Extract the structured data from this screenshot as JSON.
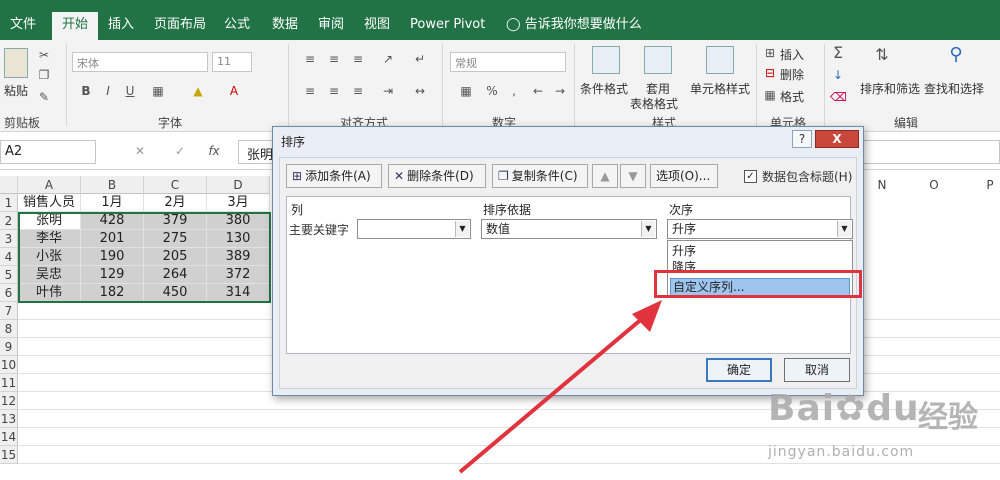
{
  "ribbon": {
    "tabs": [
      {
        "label": "文件"
      },
      {
        "label": "开始"
      },
      {
        "label": "插入"
      },
      {
        "label": "页面布局"
      },
      {
        "label": "公式"
      },
      {
        "label": "数据"
      },
      {
        "label": "审阅"
      },
      {
        "label": "视图"
      },
      {
        "label": "Power Pivot"
      }
    ],
    "tell_me": "告诉我你想要做什么",
    "clipboard": {
      "paste": "粘贴",
      "label": "剪贴板"
    },
    "font": {
      "name": "宋体",
      "size": "11",
      "label": "字体"
    },
    "alignment": {
      "label": "对齐方式"
    },
    "number": {
      "format": "常规",
      "label": "数字"
    },
    "styles": {
      "conditional": "条件格式",
      "table_format_1": "套用",
      "table_format_2": "表格格式",
      "cell_styles": "单元格样式",
      "label": "样式"
    },
    "cells": {
      "insert": "插入",
      "delete": "删除",
      "format": "格式",
      "label": "单元格"
    },
    "editing": {
      "sort_filter": "排序和筛选",
      "find_select": "查找和选择",
      "label": "编辑"
    }
  },
  "formula_bar": {
    "name_box": "A2",
    "content": "张明"
  },
  "sheet": {
    "columns": [
      "A",
      "B",
      "C",
      "D"
    ],
    "right_columns": [
      "N",
      "O",
      "P"
    ],
    "rows": [
      [
        "销售人员",
        "1月",
        "2月",
        "3月"
      ],
      [
        "张明",
        "428",
        "379",
        "380"
      ],
      [
        "李华",
        "201",
        "275",
        "130"
      ],
      [
        "小张",
        "190",
        "205",
        "389"
      ],
      [
        "吴忠",
        "129",
        "264",
        "372"
      ],
      [
        "叶伟",
        "182",
        "450",
        "314"
      ]
    ],
    "row_numbers": [
      "1",
      "2",
      "3",
      "4",
      "5",
      "6",
      "7",
      "8",
      "9",
      "10",
      "11",
      "12",
      "13",
      "14",
      "15"
    ]
  },
  "dialog": {
    "title": "排序",
    "help": "?",
    "close": "X",
    "add_condition": "添加条件(A)",
    "delete_condition": "删除条件(D)",
    "copy_condition": "复制条件(C)",
    "options": "选项(O)...",
    "has_headers": "数据包含标题(H)",
    "col_header": "列",
    "sorton_header": "排序依据",
    "order_header": "次序",
    "primary_key": "主要关键字",
    "sort_on_value": "数值",
    "order_value": "升序",
    "order_options": [
      "升序",
      "降序",
      "自定义序列..."
    ],
    "ok": "确定",
    "cancel": "取消"
  },
  "watermark": {
    "logo": "Bai",
    "logo_end": "du",
    "cn": "经验",
    "url": "jingyan.baidu.com"
  },
  "colors": {
    "accent": "#217346",
    "highlight": "#e0333d"
  }
}
